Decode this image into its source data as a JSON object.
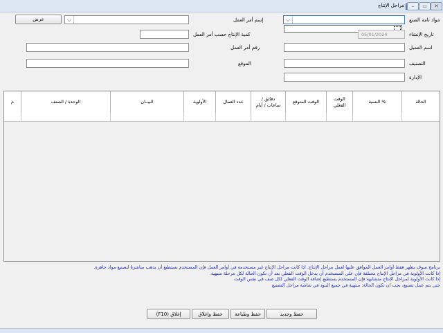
{
  "window": {
    "title": "مراحل الإنتاج",
    "minimize": "–",
    "restore": "▭",
    "close": "✕"
  },
  "form": {
    "work_order_name_label": "إسم أمر العمل",
    "work_order_name_value": "",
    "finished_goods_label": "مواد تامة الصنع",
    "finished_goods_value": "",
    "display_button": "عرض",
    "qty_label": "كمية الإنتاج حسب أمر العمل",
    "qty_value": "",
    "creation_date_label": "تاريخ الإنشاء",
    "creation_date_value": "05/01/2024",
    "work_order_no_label": "رقم أمر العمل",
    "work_order_no_value": "",
    "customer_name_label": "اسم العميل",
    "customer_name_value": "",
    "location_label": "الموقع",
    "location_value": "",
    "category_label": "التصنيف",
    "category_value": "",
    "management_label": "الإدارة",
    "management_value": ""
  },
  "grid": {
    "columns": [
      {
        "label": "الحالة"
      },
      {
        "label": "% النسبة"
      },
      {
        "label": "الوقت الفعلي"
      },
      {
        "label": "الوقت المتوقع"
      },
      {
        "label": "دقائق / ساعات / أيام"
      },
      {
        "label": "عدد العمال"
      },
      {
        "label": "الأولوية"
      },
      {
        "label": "البيــان"
      },
      {
        "label": "الوحدة / الصنف"
      },
      {
        "label": "م"
      }
    ]
  },
  "notes": [
    "برنامج سوف يظهر فقط أوامر العمل الموافق عليها لعمل مراحل الإنتاج. اذا كانت مراحل الإنتاج غير مستخدمة في أوامر العمل فإن المستخدم يستطيع أن يذهب مباشرةً لتصنيع مواد جاهزة.",
    "إذا كانت الأولوية في مراحل الإنتاج مختلفة فإن على المستخدم أن يدخل الوقت الفعلي بعد أن تكون الحالة لكل مرحلة منتهية.",
    "إذا كانت الأولوية لمراحل الإنتاج متشابهة فإن المستخدم يستطيع إضافة الوقت الفعلي لكل صف في نفس الوقت",
    "حتى يتم عمل تصنيع، يجب ان تكون الحالة: منتهية في جميع البنود في شاشة مراحل التصنيع"
  ],
  "buttons": {
    "save_new": "حفظ وجديد",
    "save_print": "حفظ وطباعة",
    "save_close": "حفظ وإغلاق",
    "close": "إغلاق (F10)"
  },
  "colors": {
    "notes_text": "#1a2cc4",
    "titlebar": "#dce6f3"
  }
}
